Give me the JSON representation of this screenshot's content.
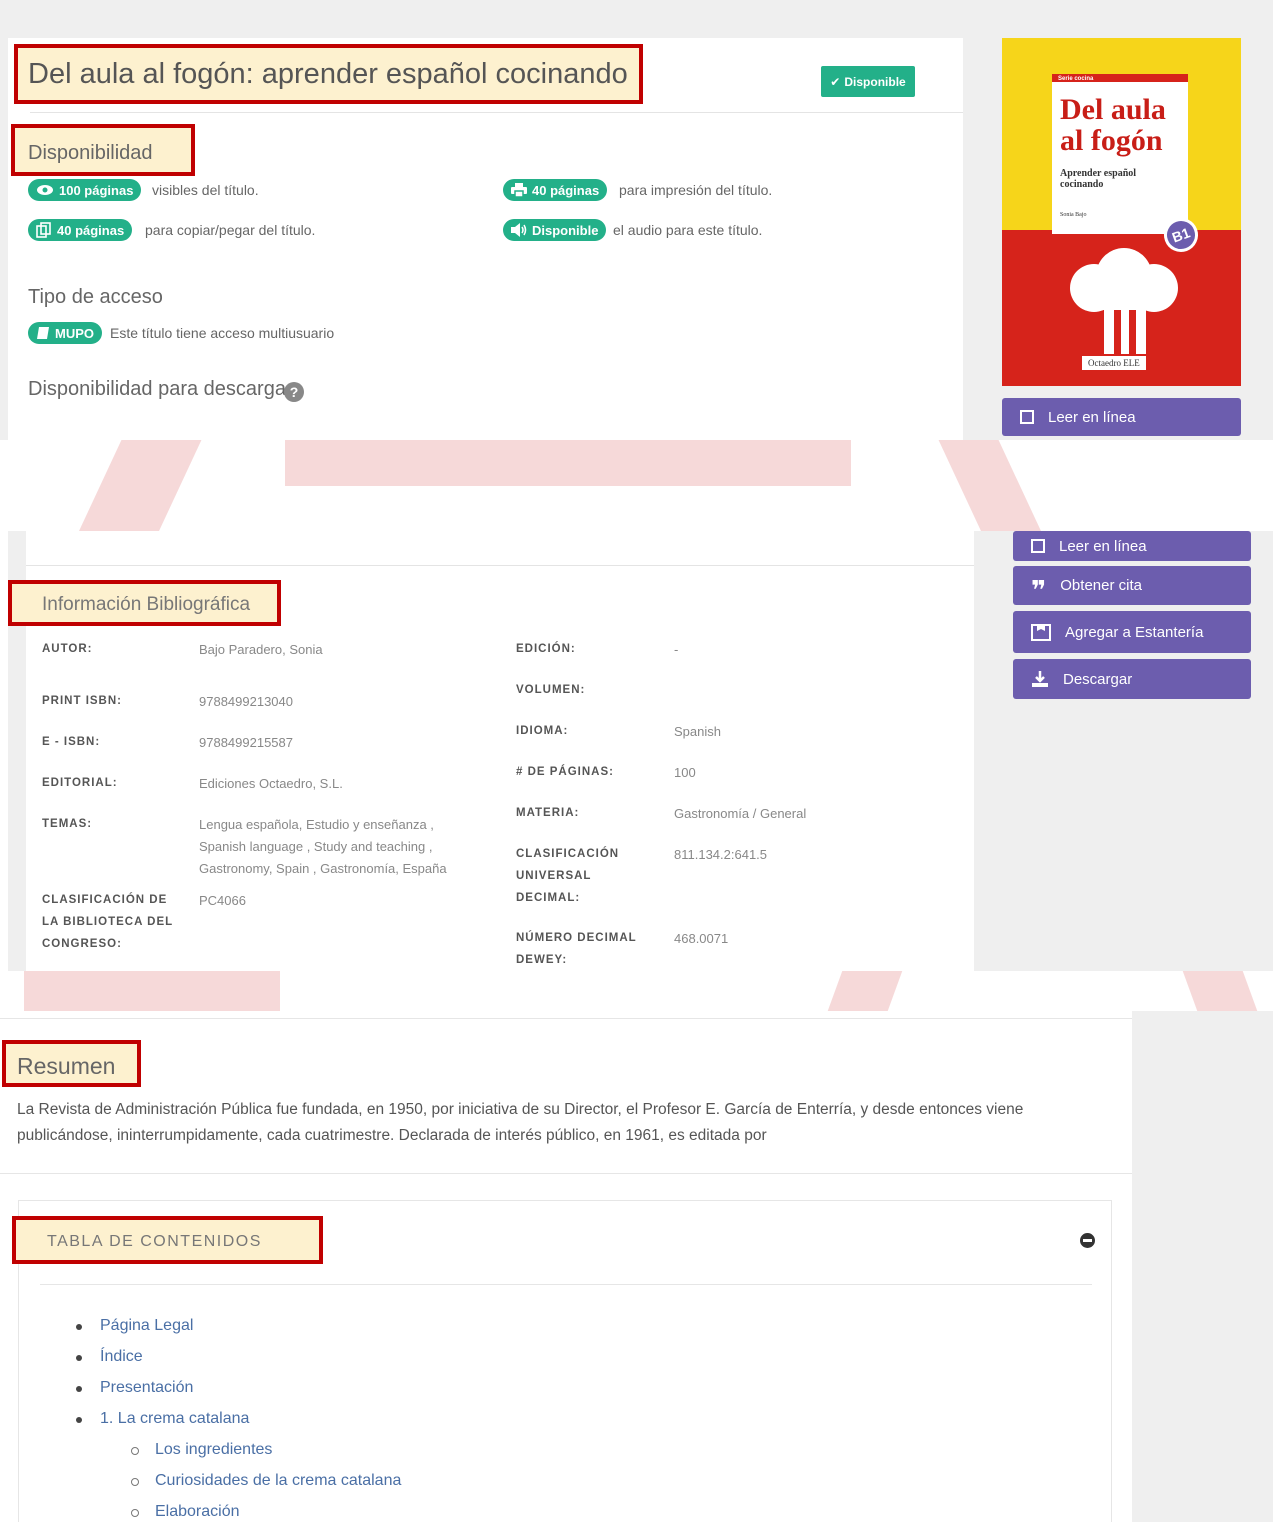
{
  "title": "Del aula al fogón: aprender español cocinando",
  "status_badge": "Disponible",
  "availability": {
    "heading": "Disponibilidad",
    "visible_pages": {
      "label": "100 páginas",
      "text": "visibles del título."
    },
    "print_pages": {
      "label": "40 páginas",
      "text": "para impresión del título."
    },
    "copy_pages": {
      "label": "40 páginas",
      "text": "para copiar/pegar del título."
    },
    "audio": {
      "label": "Disponible",
      "text": "el audio para este título."
    }
  },
  "access": {
    "heading": "Tipo de acceso",
    "badge": "MUPO",
    "text": "Este título tiene acceso multiusuario"
  },
  "download": {
    "heading": "Disponibilidad para descarga"
  },
  "cover": {
    "series": "Serie cocina",
    "title_line1": "Del aula",
    "title_line2": "al fogón",
    "subtitle": "Aprender español cocinando",
    "author": "Sonia Bajo",
    "badge": "B1",
    "publisher": "Octaedro ELE"
  },
  "actions": {
    "read_online": "Leer en línea",
    "cite": "Obtener cita",
    "shelf": "Agregar a Estantería",
    "download": "Descargar"
  },
  "biblio": {
    "heading": "Información Bibliográfica",
    "left": [
      {
        "label": "AUTOR:",
        "value": "Bajo Paradero, Sonia"
      },
      {
        "label": "PRINT ISBN:",
        "value": "9788499213040"
      },
      {
        "label": "E - ISBN:",
        "value": "9788499215587"
      },
      {
        "label": "EDITORIAL:",
        "value": "Ediciones Octaedro, S.L."
      },
      {
        "label": "TEMAS:",
        "value": "Lengua española, Estudio y enseñanza , Spanish language , Study and teaching , Gastronomy, Spain , Gastronomía, España"
      },
      {
        "label": "CLASIFICACIÓN DE LA BIBLIOTECA DEL CONGRESO:",
        "value": "PC4066"
      }
    ],
    "right": [
      {
        "label": "EDICIÓN:",
        "value": "-"
      },
      {
        "label": "VOLUMEN:",
        "value": ""
      },
      {
        "label": "IDIOMA:",
        "value": "Spanish"
      },
      {
        "label": "# DE PÁGINAS:",
        "value": "100"
      },
      {
        "label": "MATERIA:",
        "value": "Gastronomía / General"
      },
      {
        "label": "CLASIFICACIÓN UNIVERSAL DECIMAL:",
        "value": "811.134.2:641.5"
      },
      {
        "label": "NÚMERO DECIMAL DEWEY:",
        "value": "468.0071"
      }
    ]
  },
  "summary": {
    "heading": "Resumen",
    "text": "La Revista de Administración Pública fue fundada, en 1950, por iniciativa de su Director, el Profesor E. García de Enterría, y desde entonces viene publicándose, ininterrumpidamente, cada cuatrimestre. Declarada de interés público, en 1961, es editada por"
  },
  "toc": {
    "heading": "TABLA DE CONTENIDOS",
    "items": [
      "Página Legal",
      "Índice",
      "Presentación",
      "1. La crema catalana"
    ],
    "subitems": [
      "Los ingredientes",
      "Curiosidades de la crema catalana",
      "Elaboración"
    ]
  },
  "colors": {
    "accent": "#23b089",
    "purple": "#6c5dae",
    "highlight_border": "#c00000",
    "highlight_fill": "#fdf1cf",
    "link": "#4a6fa5"
  }
}
